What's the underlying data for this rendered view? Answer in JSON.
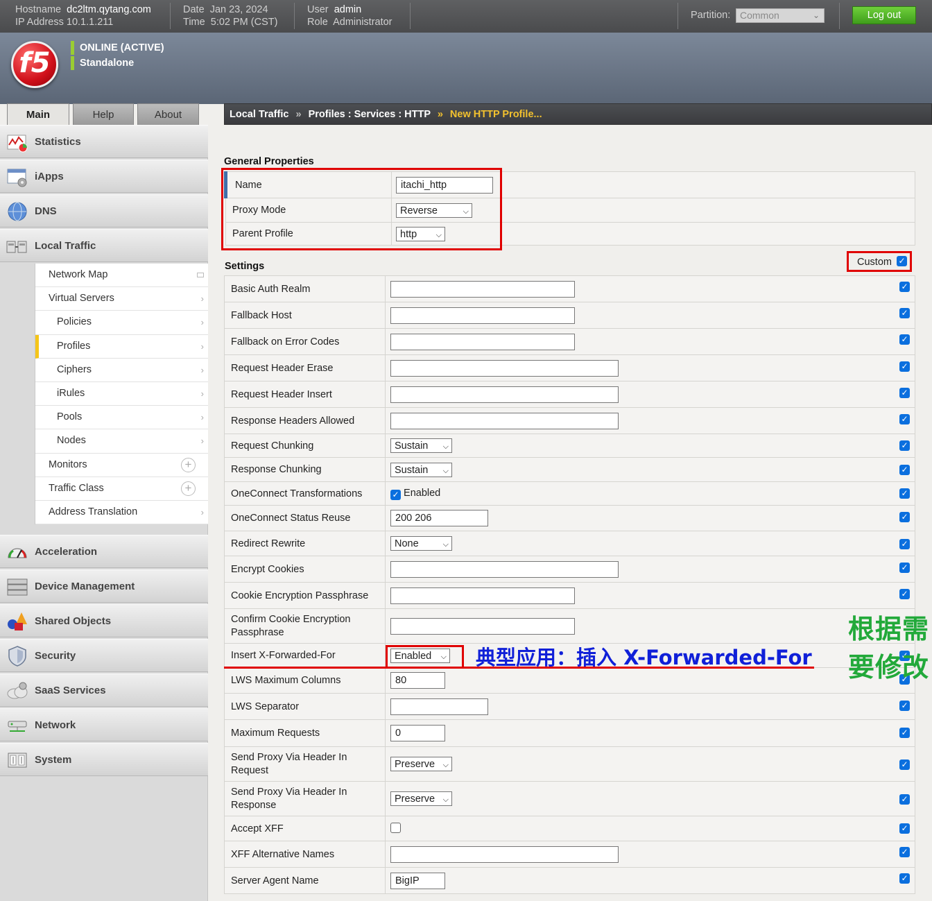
{
  "topbar": {
    "hostname_label": "Hostname",
    "hostname": "dc2ltm.qytang.com",
    "ip_label": "IP Address",
    "ip": "10.1.1.211",
    "date_label": "Date",
    "date": "Jan 23, 2024",
    "time_label": "Time",
    "time": "5:02 PM (CST)",
    "user_label": "User",
    "user": "admin",
    "role_label": "Role",
    "role": "Administrator",
    "partition_label": "Partition:",
    "partition_value": "Common",
    "logout_label": "Log out"
  },
  "banner": {
    "logo_text": "f5",
    "status1": "ONLINE (ACTIVE)",
    "status2": "Standalone"
  },
  "tabs": [
    "Main",
    "Help",
    "About"
  ],
  "breadcrumb": {
    "p1": "Local Traffic",
    "p2": "Profiles : Services : HTTP",
    "current": "New HTTP Profile...",
    "sep": "»"
  },
  "sidebar": {
    "top": [
      "Statistics",
      "iApps",
      "DNS",
      "Local Traffic"
    ],
    "submenu": [
      "Network Map",
      "Virtual Servers",
      "Policies",
      "Profiles",
      "Ciphers",
      "iRules",
      "Pools",
      "Nodes",
      "Monitors",
      "Traffic Class",
      "Address Translation"
    ],
    "bottom": [
      "Acceleration",
      "Device Management",
      "Shared Objects",
      "Security",
      "SaaS Services",
      "Network",
      "System"
    ]
  },
  "general": {
    "title": "General Properties",
    "name_label": "Name",
    "name_value": "itachi_http",
    "proxy_label": "Proxy Mode",
    "proxy_value": "Reverse",
    "parent_label": "Parent Profile",
    "parent_value": "http"
  },
  "settings": {
    "title": "Settings",
    "custom_label": "Custom",
    "rows": [
      {
        "label": "Basic Auth Realm",
        "value": ""
      },
      {
        "label": "Fallback Host",
        "value": ""
      },
      {
        "label": "Fallback on Error Codes",
        "value": ""
      },
      {
        "label": "Request Header Erase",
        "value": ""
      },
      {
        "label": "Request Header Insert",
        "value": ""
      },
      {
        "label": "Response Headers Allowed",
        "value": ""
      },
      {
        "label": "Request Chunking",
        "value": "Sustain"
      },
      {
        "label": "Response Chunking",
        "value": "Sustain"
      },
      {
        "label": "OneConnect Transformations",
        "value": "Enabled"
      },
      {
        "label": "OneConnect Status Reuse",
        "value": "200 206"
      },
      {
        "label": "Redirect Rewrite",
        "value": "None"
      },
      {
        "label": "Encrypt Cookies",
        "value": ""
      },
      {
        "label": "Cookie Encryption Passphrase",
        "value": ""
      },
      {
        "label": "Confirm Cookie Encryption Passphrase",
        "value": ""
      },
      {
        "label": "Insert X-Forwarded-For",
        "value": "Enabled"
      },
      {
        "label": "LWS Maximum Columns",
        "value": "80"
      },
      {
        "label": "LWS Separator",
        "value": ""
      },
      {
        "label": "Maximum Requests",
        "value": "0"
      },
      {
        "label": "Send Proxy Via Header In Request",
        "value": "Preserve"
      },
      {
        "label": "Send Proxy Via Header In Response",
        "value": "Preserve"
      },
      {
        "label": "Accept XFF",
        "value": ""
      },
      {
        "label": "XFF Alternative Names",
        "value": ""
      },
      {
        "label": "Server Agent Name",
        "value": "BigIP"
      }
    ]
  },
  "annotations": {
    "green": "根据需要修改",
    "blue": "典型应用：插入 X-Forwarded-For"
  },
  "colors": {
    "accent_red": "#e00000",
    "brand_red": "#d0101a",
    "online_green": "#9acd32",
    "breadcrumb_current": "#f2c12e",
    "checkbox_blue": "#0b6fde"
  }
}
